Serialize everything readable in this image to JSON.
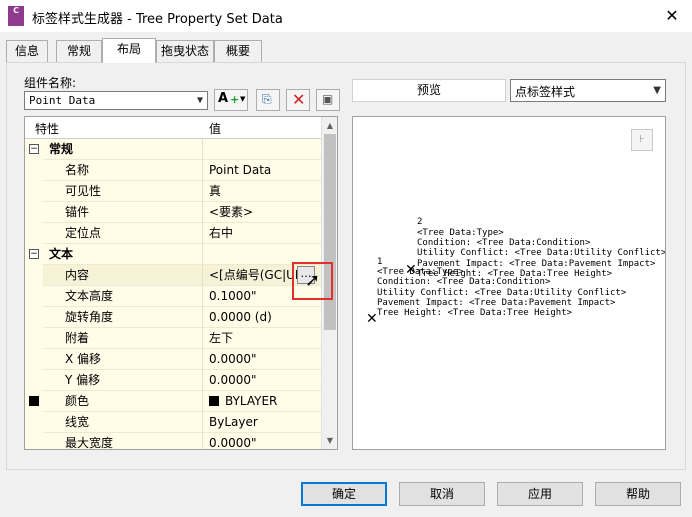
{
  "window": {
    "title": "标签样式生成器 - Tree Property Set Data",
    "app_icon_text": "C",
    "close": "✕"
  },
  "tabs": [
    {
      "label": "信息"
    },
    {
      "label": "常规"
    },
    {
      "label": "布局"
    },
    {
      "label": "拖曳状态"
    },
    {
      "label": "概要"
    }
  ],
  "active_tab": "布局",
  "component": {
    "label": "组件名称:",
    "value": "Point Data"
  },
  "preview": {
    "label": "预览",
    "style_select": "点标签样式",
    "lines_top": [
      "2",
      "<Tree Data:Type>",
      "Condition: <Tree Data:Condition>",
      "Utility Conflict: <Tree Data:Utility Conflict>",
      "Pavement Impact: <Tree Data:Pavement Impact>",
      "Tree Height: <Tree Data:Tree Height>"
    ],
    "lines_bottom": [
      "1",
      "<Tree Data:Type>",
      "Condition: <Tree Data:Condition>",
      "Utility Conflict: <Tree Data:Utility Conflict>",
      "Pavement Impact: <Tree Data:Pavement Impact>",
      "Tree Height: <Tree Data:Tree Height>"
    ]
  },
  "grid": {
    "col_property": "特性",
    "col_value": "值",
    "rows": [
      {
        "type": "category",
        "name": "常规",
        "value": ""
      },
      {
        "type": "prop",
        "name": "名称",
        "value": "Point Data"
      },
      {
        "type": "prop",
        "name": "可见性",
        "value": "真"
      },
      {
        "type": "prop",
        "name": "锚件",
        "value": "<要素>"
      },
      {
        "type": "prop",
        "name": "定位点",
        "value": "右中"
      },
      {
        "type": "category",
        "name": "文本",
        "value": ""
      },
      {
        "type": "prop",
        "name": "内容",
        "value": "<[点编号(GC|UN"
      },
      {
        "type": "prop",
        "name": "文本高度",
        "value": "0.1000\""
      },
      {
        "type": "prop",
        "name": "旋转角度",
        "value": "0.0000 (d)"
      },
      {
        "type": "prop",
        "name": "附着",
        "value": "左下"
      },
      {
        "type": "prop",
        "name": "X 偏移",
        "value": "0.0000\""
      },
      {
        "type": "prop",
        "name": "Y 偏移",
        "value": "0.0000\""
      },
      {
        "type": "prop",
        "name": "颜色",
        "value": "BYLAYER"
      },
      {
        "type": "prop",
        "name": "线宽",
        "value": "ByLayer"
      },
      {
        "type": "prop",
        "name": "最大宽度",
        "value": "0.0000\""
      }
    ]
  },
  "buttons": {
    "ok": "确定",
    "cancel": "取消",
    "apply": "应用",
    "help": "帮助"
  }
}
